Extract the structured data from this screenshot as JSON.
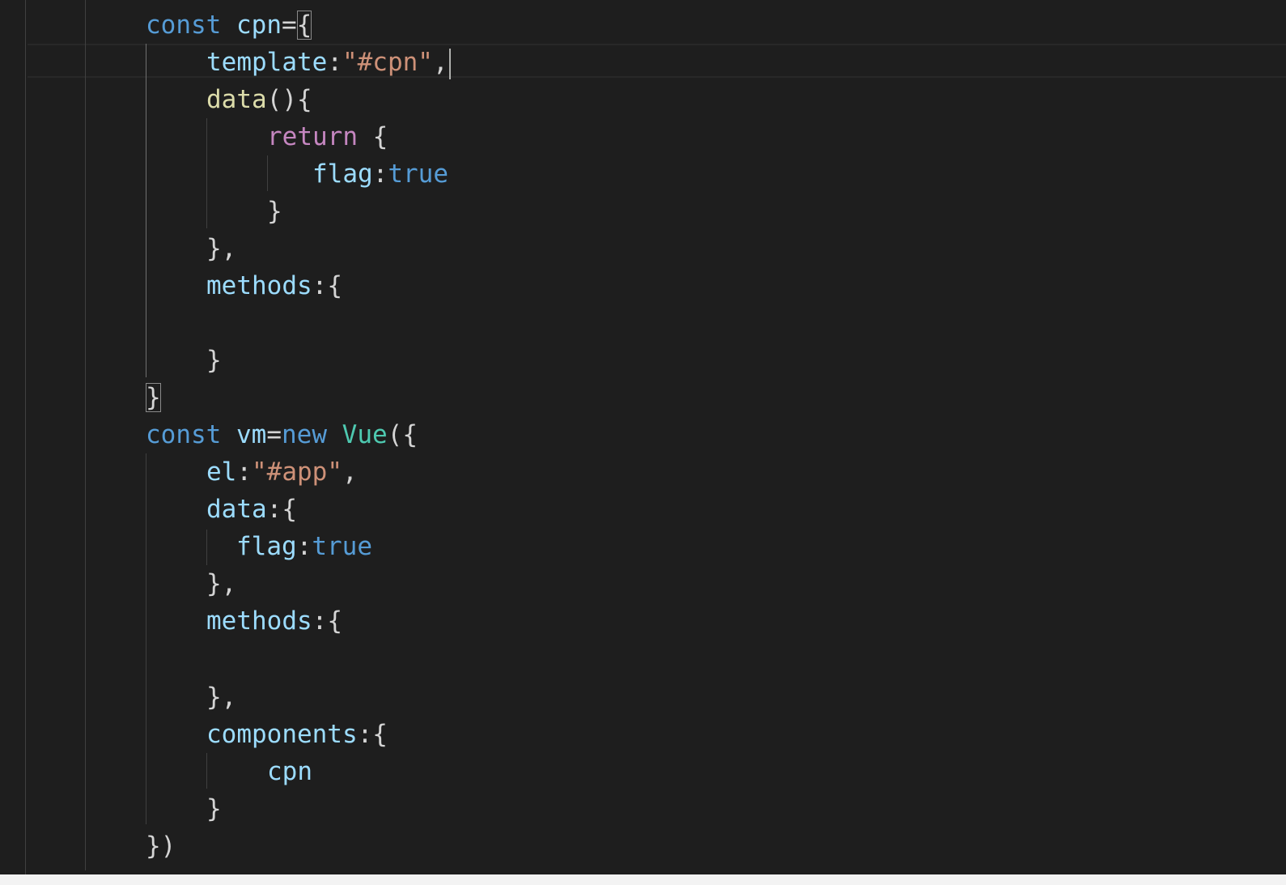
{
  "editor": {
    "language": "javascript",
    "theme_colors": {
      "background": "#1e1e1e",
      "keyword": "#569cd6",
      "variable": "#9cdcfe",
      "string": "#ce9178",
      "function": "#dcdcaa",
      "control": "#c586c0",
      "class": "#4ec9b0",
      "punctuation": "#d4d4d4"
    },
    "lines": [
      {
        "tokens": [
          "const",
          " ",
          "cpn",
          "=",
          "{"
        ]
      },
      {
        "tokens": [
          "template",
          ":",
          "\"#cpn\"",
          ","
        ]
      },
      {
        "tokens": [
          "data",
          "(){"
        ]
      },
      {
        "tokens": [
          "return",
          " {"
        ]
      },
      {
        "tokens": [
          "flag",
          ":",
          "true"
        ]
      },
      {
        "tokens": [
          "}"
        ]
      },
      {
        "tokens": [
          "},"
        ]
      },
      {
        "tokens": [
          "methods",
          ":{"
        ]
      },
      {
        "tokens": [
          ""
        ]
      },
      {
        "tokens": [
          "}"
        ]
      },
      {
        "tokens": [
          "}"
        ]
      },
      {
        "tokens": [
          "const",
          " ",
          "vm",
          "=",
          "new",
          " ",
          "Vue",
          "({"
        ]
      },
      {
        "tokens": [
          "el",
          ":",
          "\"#app\"",
          ","
        ]
      },
      {
        "tokens": [
          "data",
          ":{"
        ]
      },
      {
        "tokens": [
          "flag",
          ":",
          "true"
        ]
      },
      {
        "tokens": [
          "},"
        ]
      },
      {
        "tokens": [
          "methods",
          ":{"
        ]
      },
      {
        "tokens": [
          ""
        ]
      },
      {
        "tokens": [
          "},"
        ]
      },
      {
        "tokens": [
          "components",
          ":{"
        ]
      },
      {
        "tokens": [
          "cpn"
        ]
      },
      {
        "tokens": [
          "}"
        ]
      },
      {
        "tokens": [
          "})"
        ]
      }
    ]
  }
}
